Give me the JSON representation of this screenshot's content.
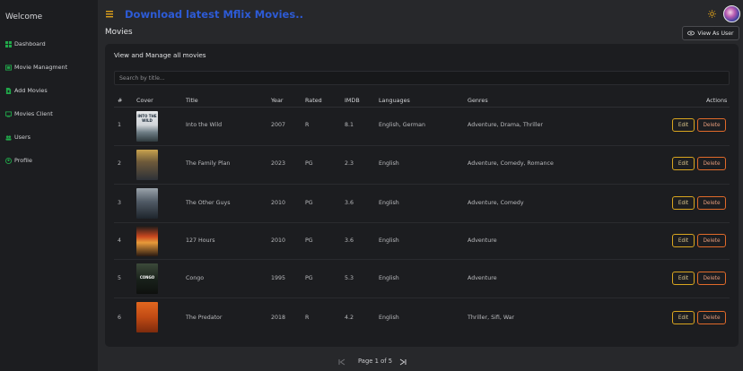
{
  "sidebar": {
    "welcome": "Welcome",
    "items": [
      {
        "label": "Dashboard",
        "icon": "dashboard-icon"
      },
      {
        "label": "Movie Managment",
        "icon": "film-icon"
      },
      {
        "label": "Add Movies",
        "icon": "document-add-icon"
      },
      {
        "label": "Movies Client",
        "icon": "tv-icon"
      },
      {
        "label": "Users",
        "icon": "users-icon"
      },
      {
        "label": "Profile",
        "icon": "profile-icon"
      }
    ]
  },
  "header": {
    "brand": "Download latest Mflix Movies..",
    "brand_color": "#2d5bd6",
    "accent_color": "#21a84a"
  },
  "page": {
    "title": "Movies",
    "view_as_user": "View As User"
  },
  "card": {
    "title": "View and Manage all movies",
    "search_placeholder": "Search by title...",
    "columns": [
      "#",
      "Cover",
      "Title",
      "Year",
      "Rated",
      "IMDB",
      "Languages",
      "Genres",
      "Actions"
    ]
  },
  "rows": [
    {
      "num": "1",
      "title": "Into the Wild",
      "year": "2007",
      "rated": "R",
      "imdb": "8.1",
      "languages": "English, German",
      "genres": "Adventure, Drama, Thriller",
      "poster_text": "INTO THE WILD"
    },
    {
      "num": "2",
      "title": "The Family Plan",
      "year": "2023",
      "rated": "PG",
      "imdb": "2.3",
      "languages": "English",
      "genres": "Adventure, Comedy, Romance",
      "poster_text": ""
    },
    {
      "num": "3",
      "title": "The Other Guys",
      "year": "2010",
      "rated": "PG",
      "imdb": "3.6",
      "languages": "English",
      "genres": "Adventure, Comedy",
      "poster_text": ""
    },
    {
      "num": "4",
      "title": "127 Hours",
      "year": "2010",
      "rated": "PG",
      "imdb": "3.6",
      "languages": "English",
      "genres": "Adventure",
      "poster_text": ""
    },
    {
      "num": "5",
      "title": "Congo",
      "year": "1995",
      "rated": "PG",
      "imdb": "5.3",
      "languages": "English",
      "genres": "Adventure",
      "poster_text": "CONGO"
    },
    {
      "num": "6",
      "title": "The Predator",
      "year": "2018",
      "rated": "R",
      "imdb": "4.2",
      "languages": "English",
      "genres": "Thriller, Sifi, War",
      "poster_text": ""
    }
  ],
  "actions": {
    "edit": "Edit",
    "delete": "Delete"
  },
  "pagination": {
    "label": "Page 1 of 5"
  }
}
